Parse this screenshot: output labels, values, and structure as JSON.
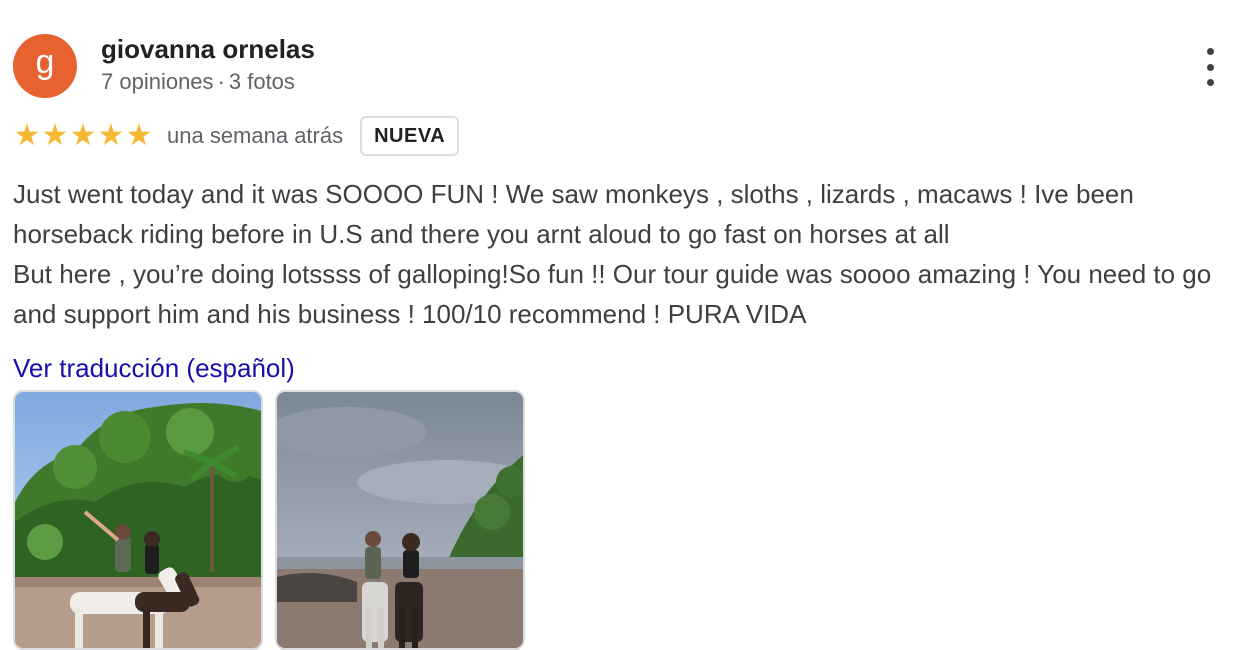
{
  "reviewer": {
    "avatar_letter": "g",
    "name": "giovanna ornelas",
    "reviews_count": "7 opiniones",
    "separator": "·",
    "photos_count": "3 fotos",
    "avatar_color": "#e8622f"
  },
  "rating": {
    "stars": 5,
    "star_glyph": "★",
    "star_color": "#f5b933",
    "date": "una semana atrás",
    "badge": "NUEVA"
  },
  "review": {
    "lines": [
      "Just went today and it was SOOOO FUN ! We saw monkeys , sloths , lizards , macaws ! Ive been horseback riding before in U.S and there you arnt aloud to go fast on horses at all",
      "But here , you’re doing lotssss of galloping!So fun !! Our tour guide was soooo amazing ! You need to go and support him and his business ! 100/10 recommend ! PURA VIDA"
    ],
    "translate_link": "Ver traducción (español)"
  },
  "photos": [
    {
      "icon": "photo-horseback-jungle"
    },
    {
      "icon": "photo-horseback-beach"
    }
  ],
  "icons": {
    "more": "more-vert-icon"
  }
}
